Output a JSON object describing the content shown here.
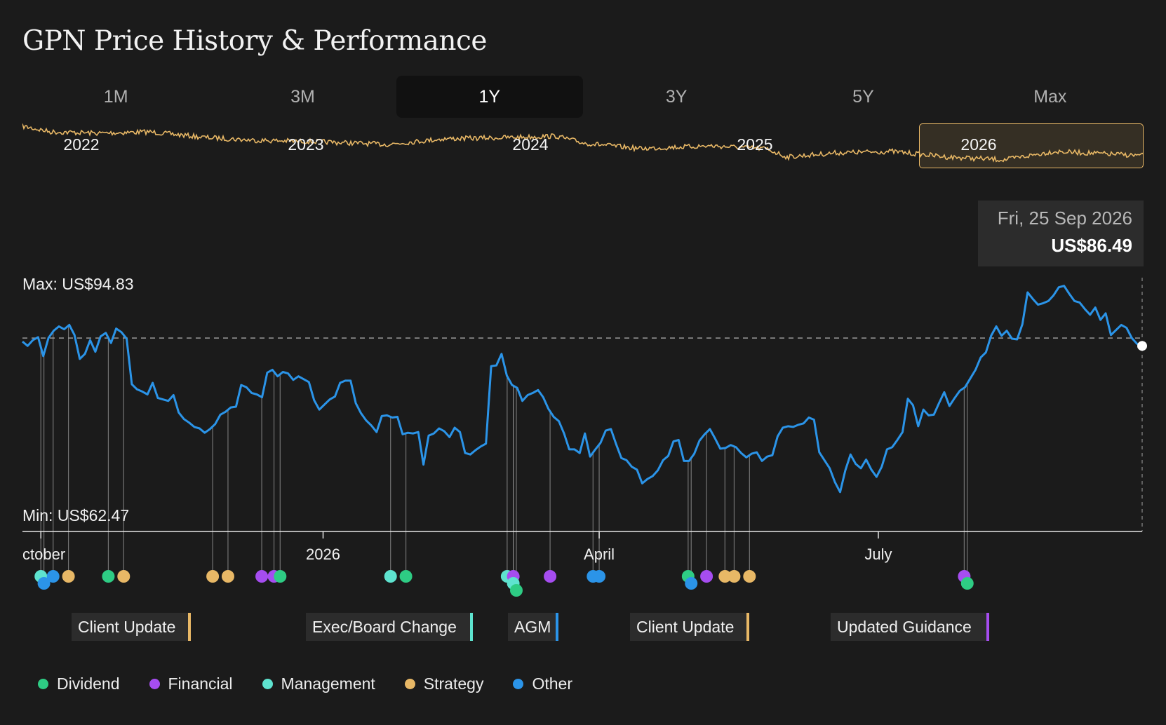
{
  "title": "GPN Price History & Performance",
  "tabs": [
    {
      "label": "1M",
      "active": false
    },
    {
      "label": "3M",
      "active": false
    },
    {
      "label": "1Y",
      "active": true
    },
    {
      "label": "3Y",
      "active": false
    },
    {
      "label": "5Y",
      "active": false
    },
    {
      "label": "Max",
      "active": false
    }
  ],
  "navigator": {
    "years": [
      "2022",
      "2023",
      "2024",
      "2025",
      "2026"
    ],
    "selected_year": "2026"
  },
  "tooltip": {
    "date": "Fri, 25 Sep 2026",
    "price": "US$86.49"
  },
  "max_label": "Max: US$94.83",
  "min_label": "Min: US$62.47",
  "legend": [
    {
      "label": "Dividend",
      "color": "#2ecc84"
    },
    {
      "label": "Financial",
      "color": "#a64df0"
    },
    {
      "label": "Management",
      "color": "#5ee3cf"
    },
    {
      "label": "Strategy",
      "color": "#e8b866"
    },
    {
      "label": "Other",
      "color": "#2b94e8"
    }
  ],
  "colors": {
    "price_line": "#2b94e8",
    "navigator_line": "#e8b866",
    "reference_line": "#9a9a9a"
  },
  "chart_data": {
    "type": "line",
    "x_ticks": [
      "ctober",
      "2026",
      "April",
      "July"
    ],
    "ylim": [
      62.47,
      94.83
    ],
    "reference_value": 86.49,
    "series": [
      {
        "values": [
          86.0,
          85.4,
          86.2,
          86.6,
          84.0,
          86.5,
          87.5,
          88.1,
          87.7,
          88.3,
          86.9,
          83.6,
          84.3,
          86.2,
          84.6,
          86.7,
          87.2,
          85.8,
          87.8,
          87.3,
          86.4,
          80.1,
          79.4,
          79.1,
          78.7,
          80.3,
          78.2,
          78.0,
          77.8,
          78.6,
          76.2,
          75.3,
          74.8,
          74.2,
          74.0,
          73.4,
          73.9,
          74.6,
          75.9,
          76.3,
          76.9,
          77.0,
          80.0,
          79.7,
          78.9,
          78.7,
          78.3,
          81.7,
          82.1,
          81.2,
          81.8,
          81.6,
          80.7,
          81.2,
          80.8,
          80.4,
          77.9,
          76.6,
          77.3,
          78.0,
          78.4,
          80.3,
          80.6,
          80.6,
          77.5,
          76.1,
          75.1,
          74.4,
          73.5,
          75.7,
          75.8,
          75.5,
          75.6,
          73.2,
          73.4,
          73.3,
          73.5,
          69.0,
          73.0,
          73.3,
          74.0,
          73.6,
          72.8,
          74.1,
          73.5,
          70.6,
          70.4,
          71.0,
          71.5,
          71.9,
          82.6,
          82.7,
          84.3,
          81.3,
          80.0,
          79.6,
          77.8,
          78.6,
          78.9,
          79.3,
          78.3,
          76.7,
          75.6,
          75.0,
          73.3,
          71.1,
          71.1,
          70.6,
          73.3,
          70.1,
          71.1,
          72.0,
          73.7,
          73.9,
          71.8,
          69.9,
          69.6,
          68.7,
          68.3,
          66.4,
          67.0,
          67.4,
          68.2,
          69.6,
          70.2,
          72.2,
          72.4,
          69.5,
          69.5,
          70.5,
          72.3,
          73.2,
          73.9,
          72.6,
          71.2,
          71.3,
          71.7,
          71.4,
          70.6,
          70.0,
          70.5,
          70.7,
          69.5,
          70.1,
          70.3,
          72.9,
          74.1,
          74.3,
          74.2,
          74.5,
          74.7,
          75.5,
          75.2,
          70.7,
          69.6,
          68.5,
          66.6,
          65.2,
          68.2,
          70.4,
          69.1,
          68.5,
          69.7,
          68.3,
          67.3,
          68.7,
          71.1,
          71.4,
          72.4,
          73.5,
          78.1,
          77.2,
          74.3,
          76.6,
          75.8,
          75.9,
          77.5,
          79.0,
          77.1,
          78.2,
          79.2,
          79.7,
          80.9,
          82.1,
          83.8,
          84.5,
          86.8,
          88.1,
          86.8,
          87.5,
          86.4,
          86.3,
          88.4,
          92.8,
          91.9,
          91.1,
          91.3,
          91.6,
          92.4,
          93.5,
          93.7,
          92.6,
          91.6,
          91.4,
          90.5,
          89.7,
          90.7,
          89.0,
          89.9,
          86.9,
          87.6,
          88.3,
          87.9,
          86.5,
          85.7,
          85.4
        ]
      }
    ],
    "events": {
      "Dividend": [
        "Oct 23 2025",
        "Dec 18 2025",
        "Jan 28 2026",
        "Mar 05 2026",
        "Apr 30 2026",
        "Jul 30 2026"
      ],
      "Financial": [
        "Dec 12 2025",
        "Dec 16 2025",
        "Mar 04 2026",
        "Mar 16 2026",
        "May 06 2026",
        "Jul 29 2026"
      ],
      "Management": [
        "Oct 01 2025",
        "Jan 23 2026",
        "Mar 02 2026",
        "Mar 04 2026"
      ],
      "Strategy": [
        "Oct 10 2025",
        "Oct 28 2025",
        "Nov 26 2025",
        "Dec 01 2025",
        "May 12 2026",
        "May 15 2026",
        "May 20 2026"
      ],
      "Other": [
        "Oct 02 2025",
        "Oct 05 2025",
        "Mar 30 2026",
        "Apr 01 2026",
        "May 01 2026"
      ]
    },
    "event_labels": [
      {
        "text": "Client Update",
        "category": "Strategy"
      },
      {
        "text": "Exec/Board Change",
        "category": "Management"
      },
      {
        "text": "AGM",
        "category": "Other"
      },
      {
        "text": "Client Update",
        "category": "Strategy"
      },
      {
        "text": "Updated Guidance",
        "category": "Financial"
      }
    ]
  }
}
